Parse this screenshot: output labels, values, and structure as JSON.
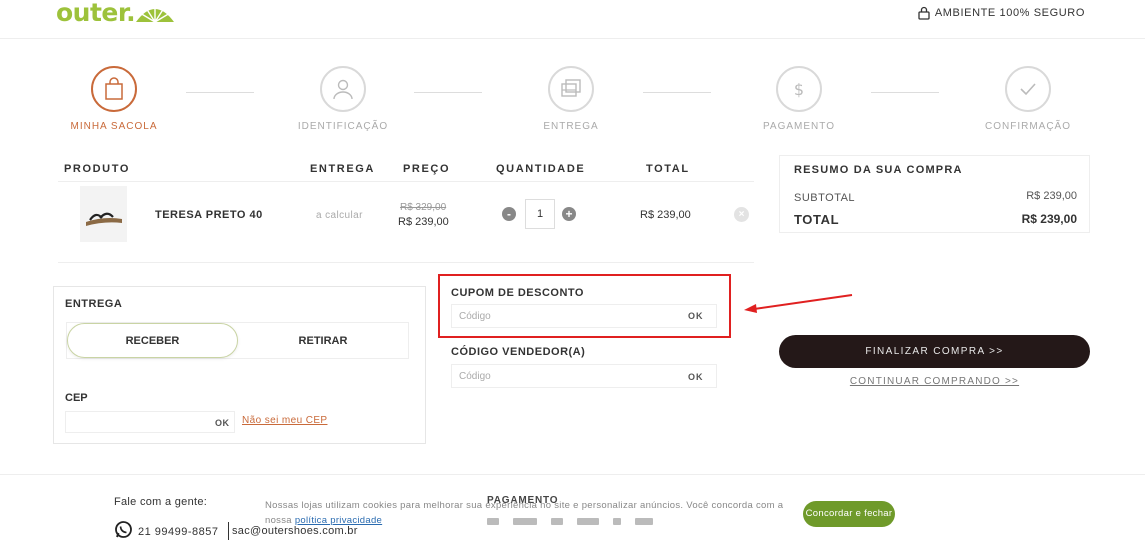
{
  "header": {
    "logo": "outer.",
    "secure_text": "AMBIENTE 100% SEGURO"
  },
  "steps": [
    {
      "label": "MINHA SACOLA",
      "icon": "bag-icon"
    },
    {
      "label": "IDENTIFICAÇÃO",
      "icon": "user-icon"
    },
    {
      "label": "ENTREGA",
      "icon": "delivery-icon"
    },
    {
      "label": "PAGAMENTO",
      "icon": "dollar-icon"
    },
    {
      "label": "CONFIRMAÇÃO",
      "icon": "check-icon"
    }
  ],
  "table": {
    "headers": {
      "produto": "PRODUTO",
      "entrega": "ENTREGA",
      "preco": "PREÇO",
      "quantidade": "QUANTIDADE",
      "total": "TOTAL"
    },
    "row": {
      "name": "TERESA PRETO 40",
      "delivery": "a calcular",
      "old_price": "R$ 329,00",
      "price": "R$ 239,00",
      "quantity": "1",
      "minus": "-",
      "plus": "+",
      "total": "R$ 239,00",
      "remove": "×"
    }
  },
  "summary": {
    "title": "RESUMO DA SUA COMPRA",
    "subtotal_label": "SUBTOTAL",
    "subtotal_value": "R$ 239,00",
    "total_label": "TOTAL",
    "total_value": "R$ 239,00"
  },
  "entrega": {
    "title": "ENTREGA",
    "receber": "RECEBER",
    "retirar": "RETIRAR",
    "cep_label": "CEP",
    "cep_ok": "OK",
    "cep_link": "Não sei meu CEP"
  },
  "coupon": {
    "label": "CUPOM DE DESCONTO",
    "placeholder": "Código",
    "ok": "OK"
  },
  "vendor": {
    "label": "CÓDIGO VENDEDOR(A)",
    "placeholder": "Código",
    "ok": "OK"
  },
  "actions": {
    "finalizar": "FINALIZAR COMPRA >>",
    "continuar": "CONTINUAR COMPRANDO >>"
  },
  "footer": {
    "fale": "Fale com a gente:",
    "phone": "21 99499-8857",
    "email": "sac@outershoes.com.br",
    "pagamento": "PAGAMENTO"
  },
  "cookie": {
    "text": "Nossas lojas utilizam cookies para melhorar sua experiência no site e personalizar anúncios. Você concorda com a nossa",
    "link": "política privacidade",
    "button": "Concordar e fechar"
  },
  "colors": {
    "brand_green": "#9dc23b",
    "active_step": "#c96a3a",
    "finalizar_bg": "#241818",
    "highlight": "#e02020",
    "cookie_button": "#6f9a2a"
  }
}
